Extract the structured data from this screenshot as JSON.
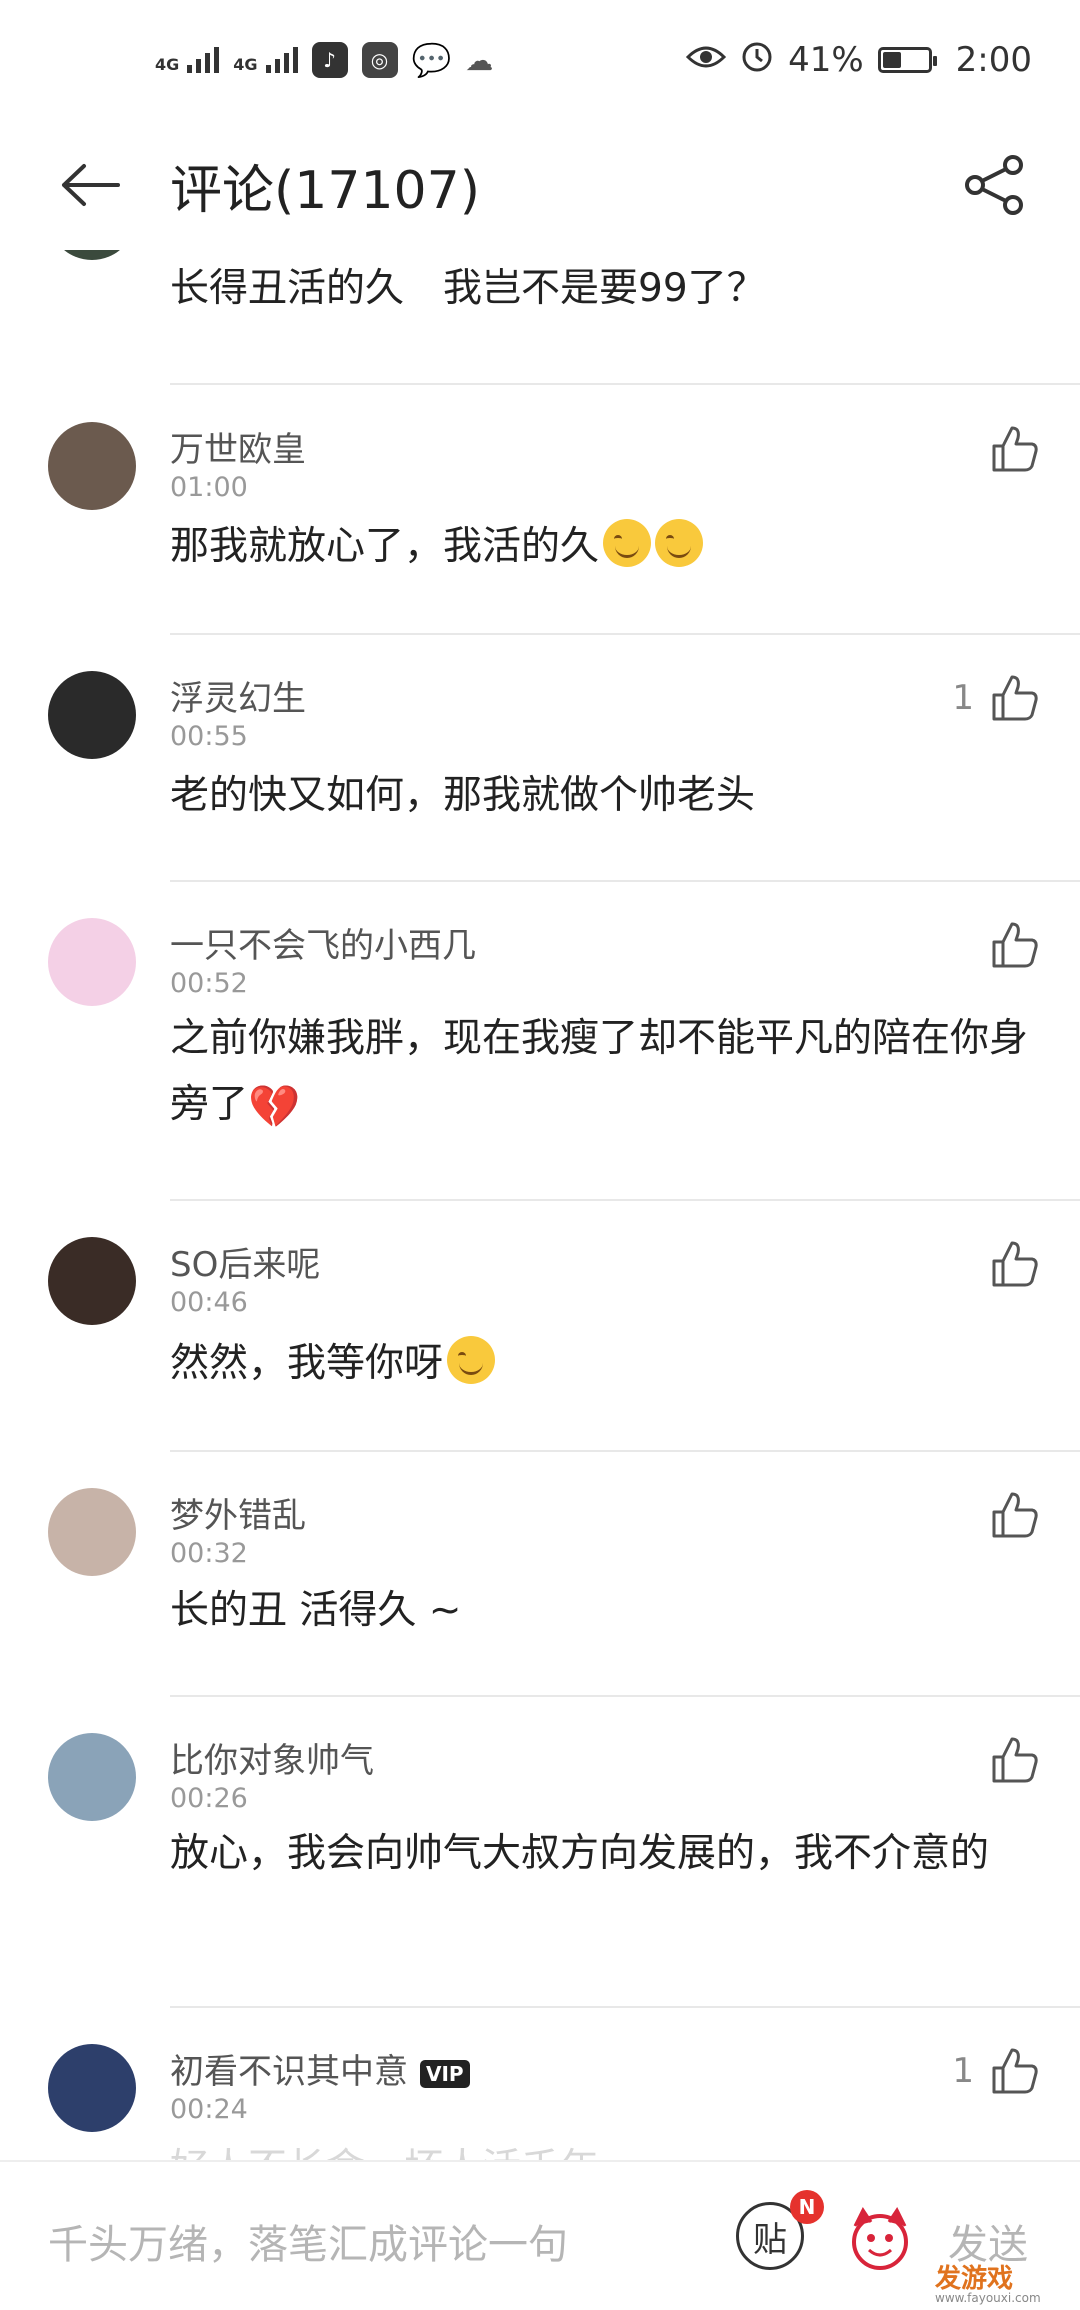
{
  "status_bar": {
    "signal_1_label": "4G",
    "signal_2_label": "4G",
    "battery_percent": "41%",
    "battery_level": 0.41,
    "time": "2:00"
  },
  "header": {
    "title": "评论(17107)"
  },
  "comments": [
    {
      "partial_text": "长得丑活的久　我岂不是要99了？"
    },
    {
      "name": "万世欧皇",
      "time": "01:00",
      "text": "那我就放心了，我活的久",
      "likes": "",
      "avatar_color": "#6b5a4e"
    },
    {
      "name": "浮灵幻生",
      "time": "00:55",
      "text": "老的快又如何，那我就做个帅老头",
      "likes": "1",
      "avatar_color": "#2a2a2a"
    },
    {
      "name": "一只不会飞的小西几",
      "time": "00:52",
      "text": "之前你嫌我胖，现在我瘦了却不能平凡的陪在你身旁了",
      "likes": "",
      "avatar_color": "#f4d0e6"
    },
    {
      "name": "SO后来呢",
      "time": "00:46",
      "text": "然然，我等你呀",
      "likes": "",
      "avatar_color": "#3a2c26"
    },
    {
      "name": "梦外错乱",
      "time": "00:32",
      "text": "长的丑 活得久 ~",
      "likes": "",
      "avatar_color": "#c7b3a8"
    },
    {
      "name": "比你对象帅气",
      "time": "00:26",
      "text": "放心，我会向帅气大叔方向发展的，我不介意的",
      "likes": "",
      "avatar_color": "#8aa3b8"
    },
    {
      "name": "初看不识其中意",
      "time": "00:24",
      "text": "好人不长命，坏人活千年。",
      "likes": "1",
      "avatar_color": "#2d3f6b",
      "badge": "VIP"
    }
  ],
  "bottom_bar": {
    "placeholder": "千头万绪，落笔汇成评论一句",
    "sticker_label": "贴",
    "badge": "N",
    "send_label": "发送",
    "watermark": "发游戏",
    "watermark_url": "www.fayouxi.com"
  },
  "colors": {
    "accent_badge": "#e5322d",
    "text_primary": "#222222",
    "text_secondary": "#999999"
  }
}
